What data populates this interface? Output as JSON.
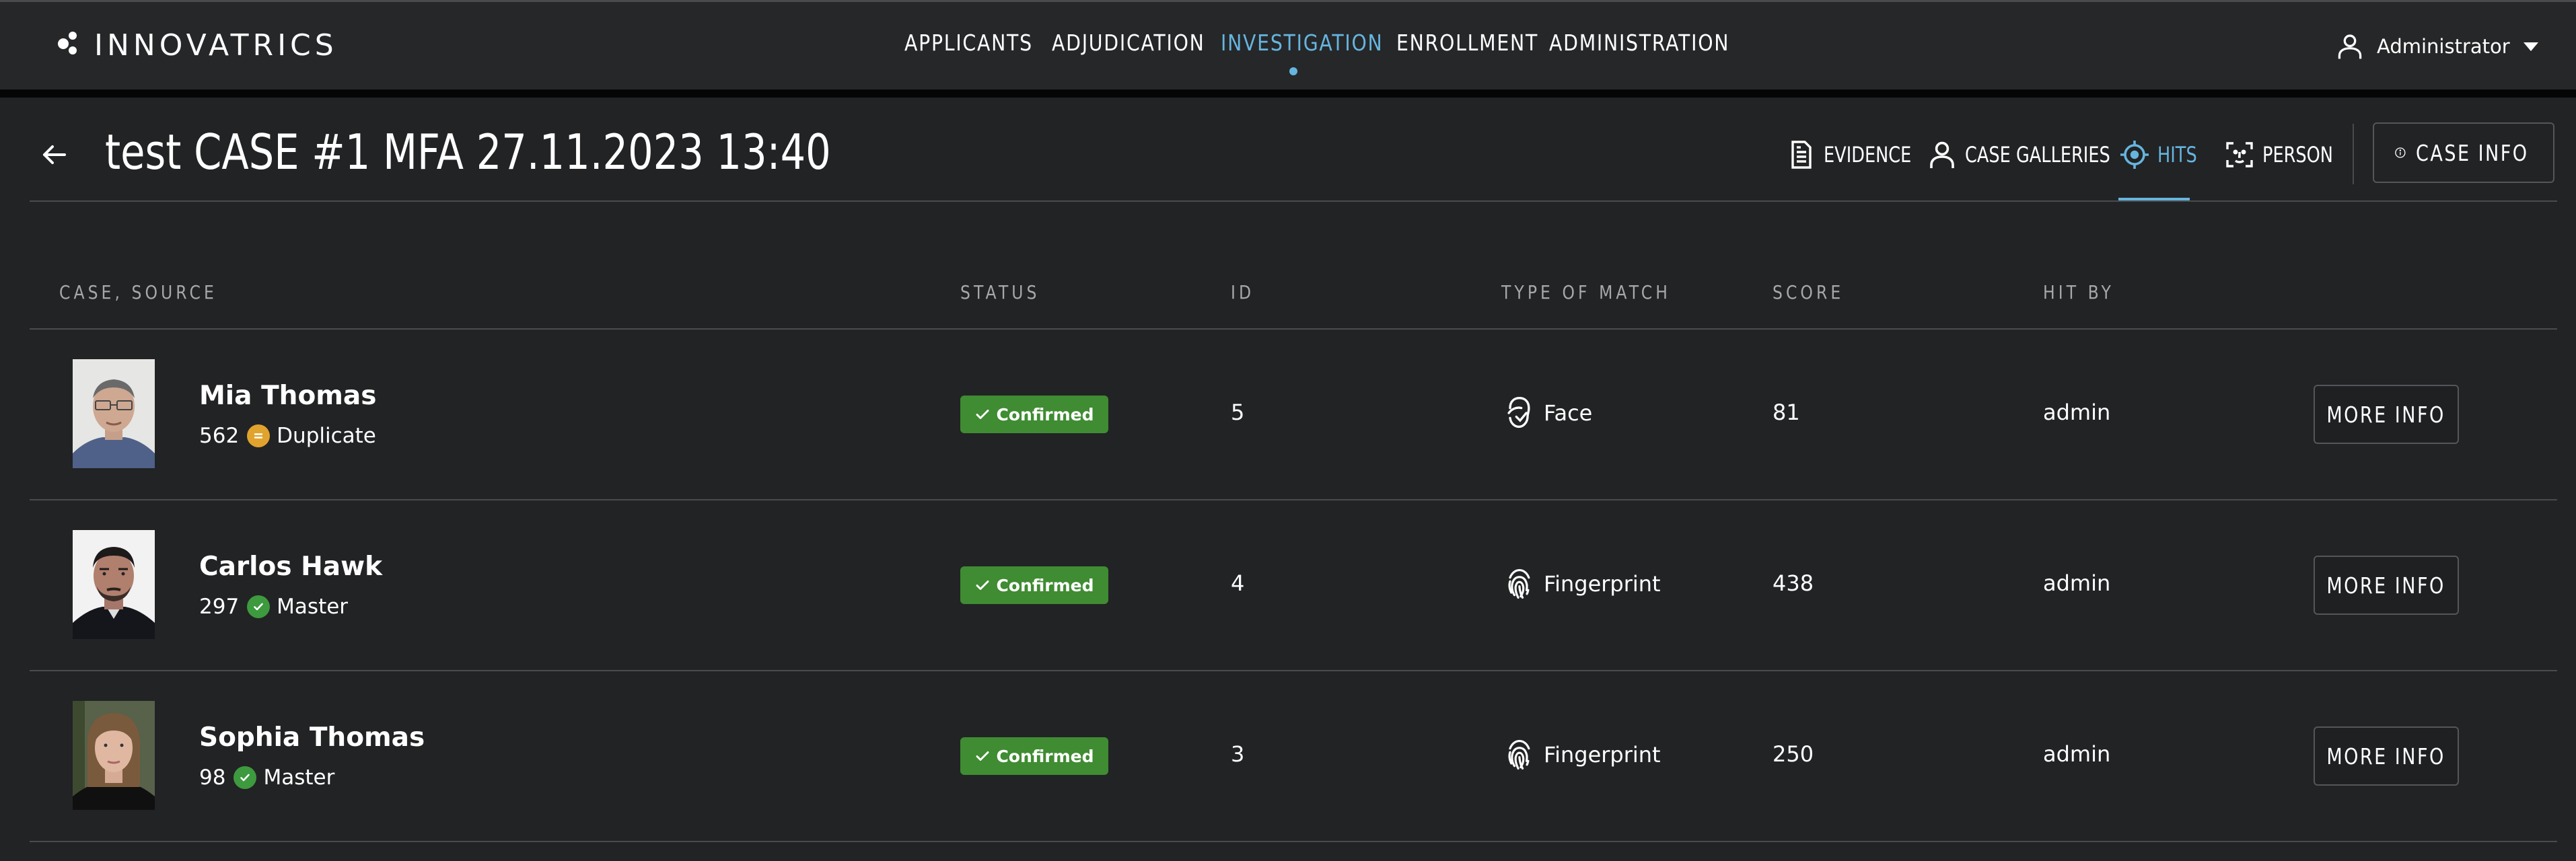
{
  "brand": {
    "name": "INNOVATRICS"
  },
  "nav": {
    "items": [
      {
        "label": "APPLICANTS",
        "active": false
      },
      {
        "label": "ADJUDICATION",
        "active": false
      },
      {
        "label": "INVESTIGATION",
        "active": true
      },
      {
        "label": "ENROLLMENT",
        "active": false
      },
      {
        "label": "ADMINISTRATION",
        "active": false
      }
    ]
  },
  "user": {
    "name": "Administrator",
    "icon": "user-icon"
  },
  "page": {
    "title": "test CASE #1 MFA 27.11.2023 13:40",
    "subnav": [
      {
        "label": "EVIDENCE",
        "icon": "document-icon",
        "active": false
      },
      {
        "label": "CASE GALLERIES",
        "icon": "person-icon",
        "active": false
      },
      {
        "label": "HITS",
        "icon": "crosshair-icon",
        "active": true
      },
      {
        "label": "PERSON",
        "icon": "face-scan-icon",
        "active": false
      }
    ],
    "case_info_label": "CASE INFO"
  },
  "table": {
    "headers": {
      "case_source": "CASE, SOURCE",
      "status": "STATUS",
      "id": "ID",
      "type_of_match": "TYPE OF MATCH",
      "score": "SCORE",
      "hit_by": "HIT BY"
    },
    "rows": [
      {
        "name": "Mia Thomas",
        "source_id": "562",
        "source_status": "Duplicate",
        "status": "Confirmed",
        "id": "5",
        "match_type": "Face",
        "score": "81",
        "hit_by": "admin",
        "action": "MORE INFO"
      },
      {
        "name": "Carlos Hawk",
        "source_id": "297",
        "source_status": "Master",
        "status": "Confirmed",
        "id": "4",
        "match_type": "Fingerprint",
        "score": "438",
        "hit_by": "admin",
        "action": "MORE INFO"
      },
      {
        "name": "Sophia Thomas",
        "source_id": "98",
        "source_status": "Master",
        "status": "Confirmed",
        "id": "3",
        "match_type": "Fingerprint",
        "score": "250",
        "hit_by": "admin",
        "action": "MORE INFO"
      }
    ]
  },
  "colors": {
    "background": "#222325",
    "accent": "#66b5df",
    "confirmed": "#3f8c32",
    "master": "#3d9a3e",
    "duplicate": "#e0a32e"
  }
}
